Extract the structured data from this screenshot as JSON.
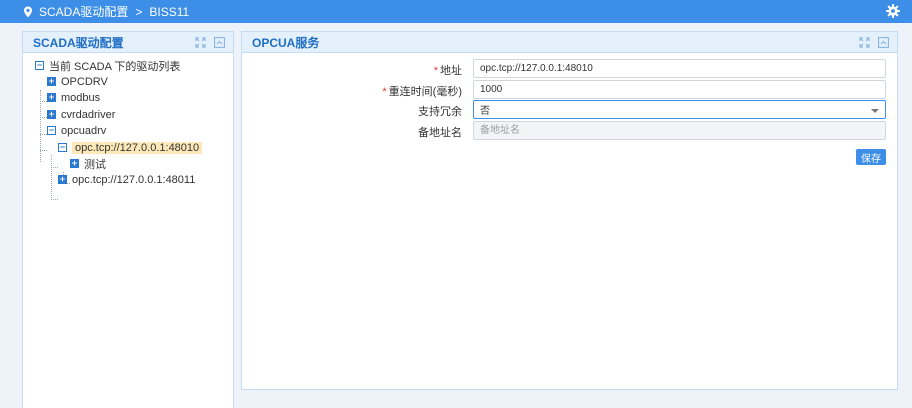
{
  "header": {
    "crumb1": "SCADA驱动配置",
    "separator": ">",
    "crumb2": "BISS11",
    "location_icon": "map-pin-icon",
    "settings_icon": "gear-icon"
  },
  "left_panel": {
    "title": "SCADA驱动配置",
    "tree": {
      "root": "当前 SCADA 下的驱动列表",
      "items": [
        "OPCDRV",
        "modbus",
        "cvrdadriver",
        "opcuadrv"
      ],
      "opcuadrv_children": [
        "opc.tcp://127.0.0.1:48010",
        "opc.tcp://127.0.0.1:48011"
      ],
      "selected_children": [
        "测试"
      ]
    }
  },
  "right_panel": {
    "title": "OPCUA服务",
    "form": {
      "address_label": "地址",
      "address_value": "opc.tcp://127.0.0.1:48010",
      "reconnect_label": "重连时间(毫秒)",
      "reconnect_value": "1000",
      "redundancy_label": "支持冗余",
      "redundancy_value": "否",
      "backup_label": "备地址名",
      "backup_placeholder": "备地址名",
      "required_mark": "*"
    },
    "save_label": "保存"
  },
  "colors": {
    "header_bg": "#3d8ee6",
    "panel_title": "#1f6ec4",
    "panel_head_bg": "#e4f0fc",
    "selection_bg": "#fde9b7",
    "required": "#e53935"
  }
}
